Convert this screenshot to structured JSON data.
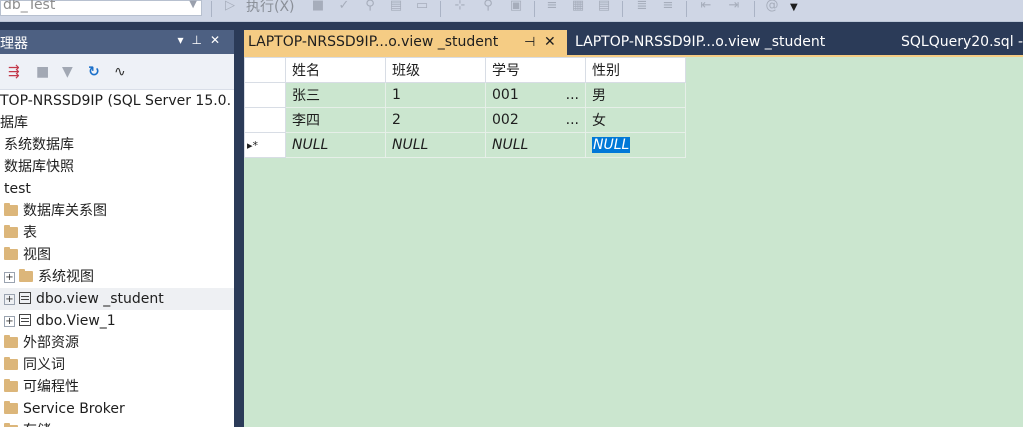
{
  "toolbar": {
    "database": "db_Test",
    "execute_label": "执行(X)"
  },
  "explorer": {
    "title": "理器",
    "tree": [
      {
        "label": "TOP-NRSSD9IP (SQL Server 15.0.",
        "icon": "none",
        "expander": false
      },
      {
        "label": "据库",
        "icon": "none",
        "expander": false
      },
      {
        "label": "系统数据库",
        "icon": "none",
        "expander": false
      },
      {
        "label": "数据库快照",
        "icon": "none",
        "expander": false
      },
      {
        "label": "test",
        "icon": "none",
        "expander": false
      },
      {
        "label": "数据库关系图",
        "icon": "folder",
        "expander": false
      },
      {
        "label": "表",
        "icon": "folder",
        "expander": false
      },
      {
        "label": "视图",
        "icon": "folder",
        "expander": false
      },
      {
        "label": "系统视图",
        "icon": "folder",
        "expander": true
      },
      {
        "label": "dbo.view _student",
        "icon": "view",
        "expander": true,
        "selected": true
      },
      {
        "label": "dbo.View_1",
        "icon": "view",
        "expander": true
      },
      {
        "label": "外部资源",
        "icon": "folder",
        "expander": false
      },
      {
        "label": "同义词",
        "icon": "folder",
        "expander": false
      },
      {
        "label": "可编程性",
        "icon": "folder",
        "expander": false
      },
      {
        "label": "Service Broker",
        "icon": "folder",
        "expander": false
      },
      {
        "label": "存储",
        "icon": "folder",
        "expander": false
      }
    ]
  },
  "tabs": [
    {
      "label": "LAPTOP-NRSSD9IP...o.view _student",
      "active": true
    },
    {
      "label": "LAPTOP-NRSSD9IP...o.view _student",
      "active": false
    },
    {
      "label": "SQLQuery20.sql -",
      "active": false
    }
  ],
  "grid": {
    "columns": [
      "姓名",
      "班级",
      "学号",
      "性别"
    ],
    "rows": [
      [
        "张三",
        "1",
        "001",
        "男"
      ],
      [
        "李四",
        "2",
        "002",
        "女"
      ]
    ],
    "new_row_marker": "▸*",
    "null_text": "NULL",
    "ellipsis": "..."
  }
}
